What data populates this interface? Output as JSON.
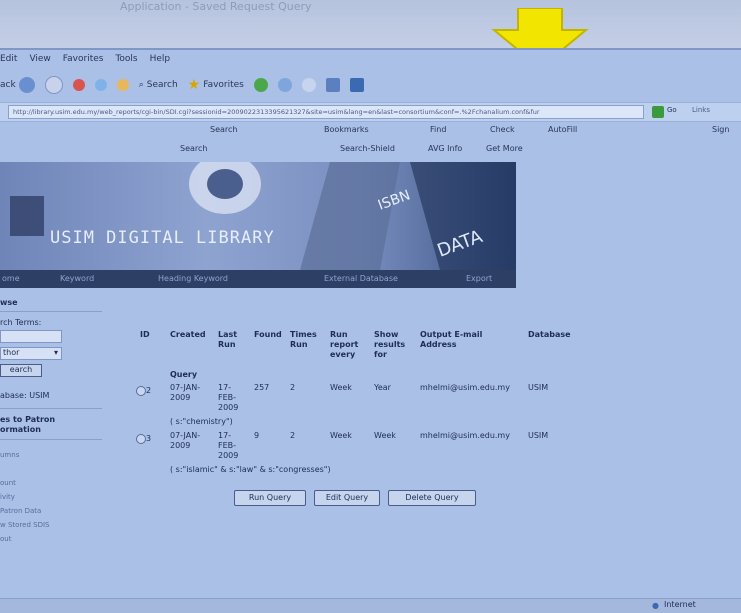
{
  "slide": {
    "faint_text": "Application - Saved Request Query"
  },
  "menu": {
    "items": [
      "Edit",
      "View",
      "Favorites",
      "Tools",
      "Help"
    ]
  },
  "toolbar": {
    "back_label": "ack",
    "search_label": "Search",
    "favorites_label": "Favorites"
  },
  "address": {
    "url": "http://library.usim.edu.my/web_reports/cgi-bin/SDI.cgi?sessionid=2009022313395621327&site=usim&lang=en&last=consortium&conf=.%2Fchanalium.conf&fur",
    "go_label": "Go",
    "links_label": "Links"
  },
  "toolbar2": {
    "search_label": "Search",
    "bookmarks_label": "Bookmarks",
    "find_label": "Find",
    "check_label": "Check",
    "autofill_label": "AutoFill",
    "sign_label": "Sign"
  },
  "toolbar3": {
    "search_label": "Search",
    "search_shield_label": "Search-Shield",
    "avg_info_label": "AVG Info",
    "get_more_label": "Get More"
  },
  "banner": {
    "title": "USIM DIGITAL LIBRARY",
    "isbn_text": "ISBN",
    "data_text": "DATA"
  },
  "nav": {
    "items": [
      "ome",
      "Keyword",
      "Heading Keyword",
      "External Database",
      "Export"
    ]
  },
  "sidebar": {
    "section1": "wse",
    "search_terms_label": "rch Terms:",
    "select_value": "thor",
    "search_btn": "earch",
    "database_label": "abase: USIM",
    "section2": "es to Patron ormation",
    "links": [
      "umns",
      "",
      "ount",
      "ivity",
      "Patron Data",
      "w Stored SDIS",
      "out"
    ]
  },
  "table": {
    "headers": [
      "ID",
      "Created",
      "Last Run",
      "Found",
      "Times Run",
      "Run report every",
      "Show results for",
      "Output E-mail Address",
      "Database"
    ],
    "query_label": "Query",
    "rows": [
      {
        "id": "2",
        "created": "07-JAN-2009",
        "last_run": "17-FEB-2009",
        "found": "257",
        "times_run": "2",
        "run_every": "Week",
        "show_for": "Year",
        "email": "mhelmi@usim.edu.my",
        "database": "USIM",
        "query": "( s:\"chemistry\")"
      },
      {
        "id": "3",
        "created": "07-JAN-2009",
        "last_run": "17-FEB-2009",
        "found": "9",
        "times_run": "2",
        "run_every": "Week",
        "show_for": "Week",
        "email": "mhelmi@usim.edu.my",
        "database": "USIM",
        "query": "( s:\"islamic\" & s:\"law\" & s:\"congresses\")"
      }
    ]
  },
  "buttons": {
    "run": "Run Query",
    "edit": "Edit Query",
    "delete": "Delete Query"
  },
  "status": {
    "zone": "Internet"
  }
}
